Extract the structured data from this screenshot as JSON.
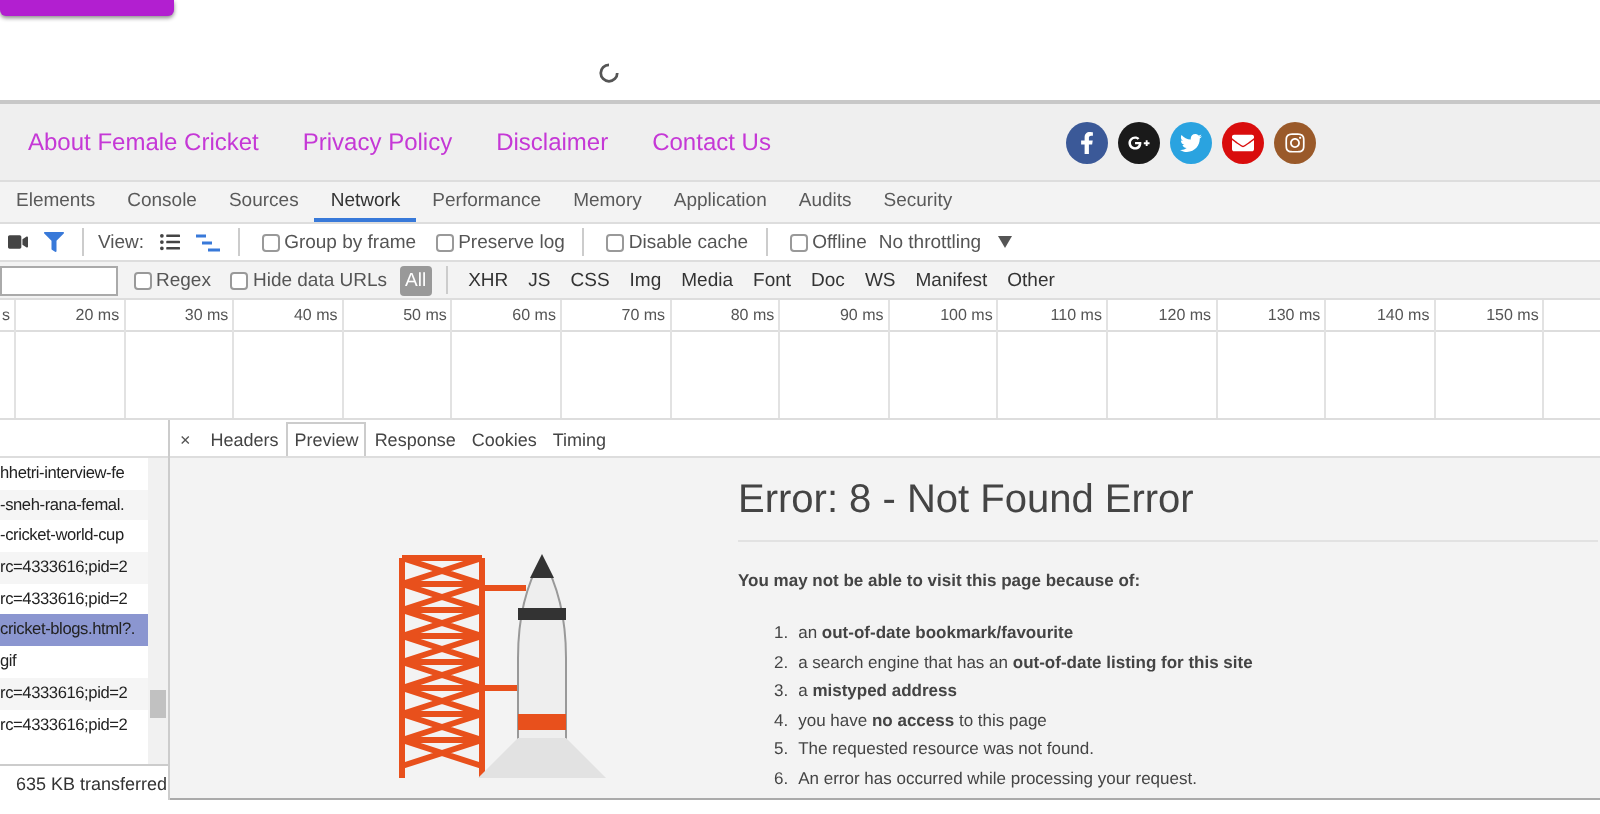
{
  "footer": {
    "links": [
      "About Female Cricket",
      "Privacy Policy",
      "Disclaimer",
      "Contact Us"
    ]
  },
  "devtools": {
    "tabs": [
      {
        "label": "Elements",
        "selected": false
      },
      {
        "label": "Console",
        "selected": false
      },
      {
        "label": "Sources",
        "selected": false
      },
      {
        "label": "Network",
        "selected": true
      },
      {
        "label": "Performance",
        "selected": false
      },
      {
        "label": "Memory",
        "selected": false
      },
      {
        "label": "Application",
        "selected": false
      },
      {
        "label": "Audits",
        "selected": false
      },
      {
        "label": "Security",
        "selected": false
      }
    ],
    "toolbar": {
      "filter_on": true,
      "view_label": "View:",
      "waterfall_on": true,
      "checkboxes": [
        {
          "label": "Group by frame",
          "checked": false
        },
        {
          "label": "Preserve log",
          "checked": false
        },
        {
          "label": "Disable cache",
          "checked": false
        },
        {
          "label": "Offline",
          "checked": false
        }
      ],
      "throttling": "No throttling"
    },
    "filter_bar": {
      "regex": {
        "label": "Regex",
        "checked": false
      },
      "hide_data_urls": {
        "label": "Hide data URLs",
        "checked": false
      },
      "types": [
        {
          "label": "All",
          "selected": true
        },
        {
          "label": "XHR",
          "selected": false
        },
        {
          "label": "JS",
          "selected": false
        },
        {
          "label": "CSS",
          "selected": false
        },
        {
          "label": "Img",
          "selected": false
        },
        {
          "label": "Media",
          "selected": false
        },
        {
          "label": "Font",
          "selected": false
        },
        {
          "label": "Doc",
          "selected": false
        },
        {
          "label": "WS",
          "selected": false
        },
        {
          "label": "Manifest",
          "selected": false
        },
        {
          "label": "Other",
          "selected": false
        }
      ]
    },
    "timeline": {
      "ticks": [
        "s",
        "20 ms",
        "30 ms",
        "40 ms",
        "50 ms",
        "60 ms",
        "70 ms",
        "80 ms",
        "90 ms",
        "100 ms",
        "110 ms",
        "120 ms",
        "130 ms",
        "140 ms",
        "150 ms"
      ]
    },
    "requests": [
      {
        "name": "hhetri-interview-fe",
        "selected": false
      },
      {
        "name": "-sneh-rana-femal.",
        "selected": false
      },
      {
        "name": "-cricket-world-cup",
        "selected": false
      },
      {
        "name": "rc=4333616;pid=2",
        "selected": false
      },
      {
        "name": "rc=4333616;pid=2",
        "selected": false
      },
      {
        "name": "cricket-blogs.html?.",
        "selected": true
      },
      {
        "name": "gif",
        "selected": false
      },
      {
        "name": "rc=4333616;pid=2",
        "selected": false
      },
      {
        "name": "rc=4333616;pid=2",
        "selected": false
      }
    ],
    "summary": "635 KB transferred",
    "detail_close": "×",
    "detail_tabs": [
      {
        "label": "Headers",
        "selected": false
      },
      {
        "label": "Preview",
        "selected": true
      },
      {
        "label": "Response",
        "selected": false
      },
      {
        "label": "Cookies",
        "selected": false
      },
      {
        "label": "Timing",
        "selected": false
      }
    ],
    "preview": {
      "title": "Error: 8 - Not Found Error",
      "intro": "You may not be able to visit this page because of:",
      "reasons": [
        {
          "number": "1.",
          "text": "an **out-of-date bookmark/favourite**"
        },
        {
          "number": "2.",
          "text": "a search engine that has an **out-of-date listing for this site**"
        },
        {
          "number": "3.",
          "text": "a **mistyped address**"
        },
        {
          "number": "4.",
          "text": "you have **no access** to this page"
        },
        {
          "number": "5.",
          "text": "The requested resource was not found."
        },
        {
          "number": "6.",
          "text": "An error has occurred while processing your request."
        }
      ]
    }
  }
}
